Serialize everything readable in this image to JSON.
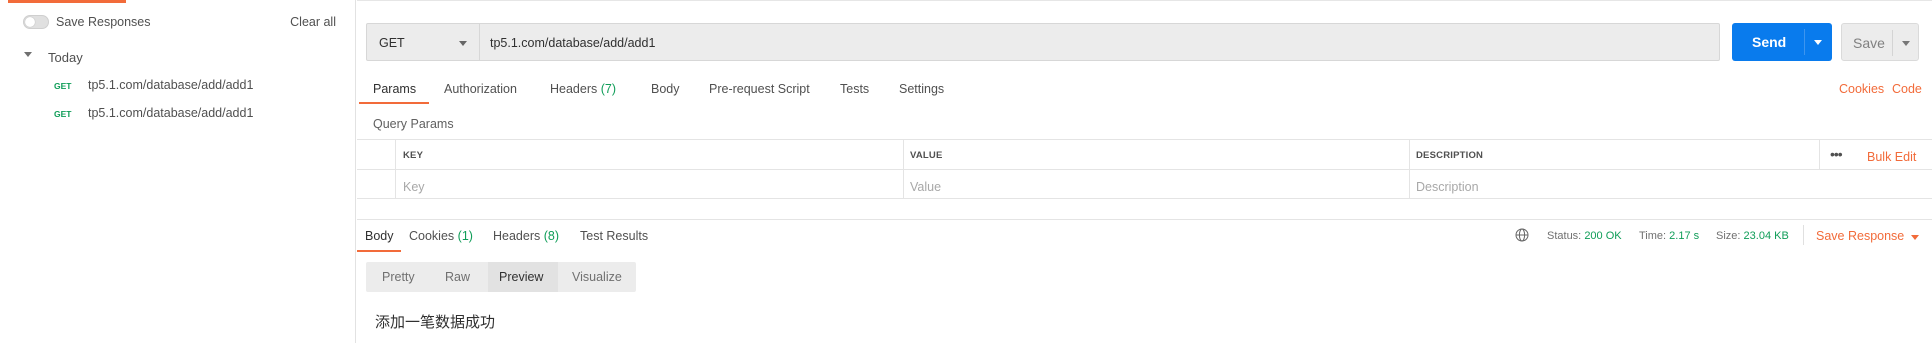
{
  "sidebar": {
    "save_responses_label": "Save Responses",
    "save_responses_on": false,
    "clear_all_label": "Clear all",
    "group_label": "Today",
    "history": [
      {
        "method": "GET",
        "url": "tp5.1.com/database/add/add1"
      },
      {
        "method": "GET",
        "url": "tp5.1.com/database/add/add1"
      }
    ]
  },
  "request": {
    "method": "GET",
    "url": "tp5.1.com/database/add/add1",
    "send_label": "Send",
    "save_label": "Save"
  },
  "request_tabs": {
    "params": "Params",
    "authorization": "Authorization",
    "headers": "Headers",
    "headers_count": "(7)",
    "body": "Body",
    "pre_request": "Pre-request Script",
    "tests": "Tests",
    "settings": "Settings",
    "cookies_link": "Cookies",
    "code_link": "Code"
  },
  "query_params": {
    "title": "Query Params",
    "columns": {
      "key": "KEY",
      "value": "VALUE",
      "description": "DESCRIPTION"
    },
    "placeholders": {
      "key": "Key",
      "value": "Value",
      "description": "Description"
    },
    "more_icon": "•••",
    "bulk_edit": "Bulk Edit"
  },
  "response_tabs": {
    "body": "Body",
    "cookies": "Cookies",
    "cookies_count": "(1)",
    "headers": "Headers",
    "headers_count": "(8)",
    "test_results": "Test Results"
  },
  "response_meta": {
    "status_label": "Status:",
    "status_value": "200 OK",
    "time_label": "Time:",
    "time_value": "2.17 s",
    "size_label": "Size:",
    "size_value": "23.04 KB",
    "save_response": "Save Response"
  },
  "view_modes": {
    "pretty": "Pretty",
    "raw": "Raw",
    "preview": "Preview",
    "visualize": "Visualize",
    "active": "Preview"
  },
  "response_body": "添加一笔数据成功",
  "colors": {
    "accent": "#f26b3a",
    "send_blue": "#097bed",
    "success_green": "#0f9d58"
  }
}
